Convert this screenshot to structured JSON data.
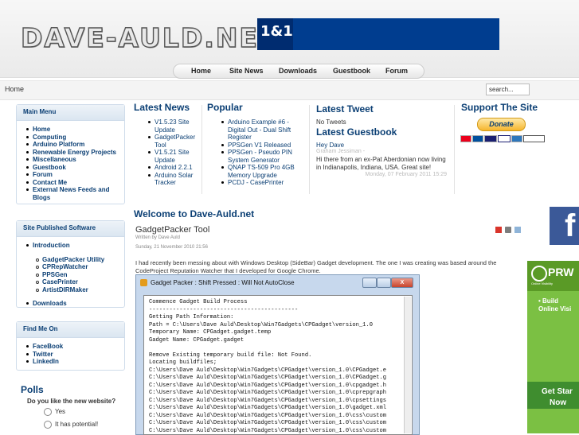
{
  "header": {
    "logo_text": "DAVE-AULD.NET",
    "banner_logo": "1&1",
    "nav": [
      "Home",
      "Site News",
      "Downloads",
      "Guestbook",
      "Forum"
    ]
  },
  "breadcrumb": "Home",
  "search": {
    "value": "search..."
  },
  "sidebar": {
    "main_menu": {
      "title": "Main Menu",
      "items": [
        "Home",
        "Computing",
        "Arduino Platform",
        "Renewable Energy Projects",
        "Miscellaneous",
        "Guestbook",
        "Forum",
        "Contact Me",
        "External News Feeds and Blogs"
      ]
    },
    "software": {
      "title": "Site Published Software",
      "items": [
        "Introduction",
        "GadgetPacker Utility",
        "CPRepWatcher",
        "PPSGen",
        "CasePrinter",
        "ArtistDIRMaker",
        "Downloads"
      ]
    },
    "find_me": {
      "title": "Find Me On",
      "items": [
        "FaceBook",
        "Twitter",
        "LinkedIn"
      ]
    },
    "polls": {
      "title": "Polls",
      "question": "Do you like the new website?",
      "options": [
        "Yes",
        "It has potential!"
      ]
    }
  },
  "latest_news": {
    "title": "Latest News",
    "items": [
      "V1.5.23 Site Update",
      "GadgetPacker Tool",
      "V1.5.21 Site Update",
      "Android 2.2.1",
      "Arduino Solar Tracker"
    ]
  },
  "popular": {
    "title": "Popular",
    "items": [
      "Arduino Example #6 - Digital Out - Dual Shift Register",
      "PPSGen V1 Released",
      "PPSGen - Pseudo PIN System Generator",
      "QNAP TS-509 Pro 4GB Memory Upgrade",
      "PCDJ - CasePrinter"
    ]
  },
  "tweet": {
    "title": "Latest Tweet",
    "text": "No Tweets"
  },
  "guestbook": {
    "title": "Latest Guestbook",
    "entry_title": "Hey Dave",
    "author": "Graham Jessiman -",
    "text": "Hi there from an ex-Pat Aberdonian now living in Indianapolis, Indiana, USA. Great site!",
    "date": "Monday, 07 February 2011 15:29"
  },
  "support": {
    "title": "Support The Site",
    "button": "Donate"
  },
  "article": {
    "section": "Welcome to Dave-Auld.net",
    "title": "GadgetPacker Tool",
    "author": "Written by Dave Auld",
    "date": "Sunday, 21 November 2010 21:56",
    "body": "I had recently been messing about with Windows Desktop (SideBar) Gadget development. The one I was creating was based around the CodeProject Reputation Watcher that I developed for Google Chrome."
  },
  "window": {
    "title": "Gadget Packer : Shift Pressed : Will Not AutoClose",
    "close_label": "X",
    "lines": [
      "Commence Gadget Build Process",
      "--------------------------------------------",
      "Getting Path Information:",
      "Path = C:\\Users\\Dave Auld\\Desktop\\Win7Gadgets\\CPGadget\\version_1.0",
      "Temporary Name: CPGadget.gadget.temp",
      "Gadget Name: CPGadget.gadget",
      "",
      "Remove Existing temporary build file: Not Found.",
      "Locating buildfiles;",
      "C:\\Users\\Dave Auld\\Desktop\\Win7Gadgets\\CPGadget\\version_1.0\\CPGadget.e",
      "C:\\Users\\Dave Auld\\Desktop\\Win7Gadgets\\CPGadget\\version_1.0\\CPGadget.g",
      "C:\\Users\\Dave Auld\\Desktop\\Win7Gadgets\\CPGadget\\version_1.0\\cpgadget.h",
      "C:\\Users\\Dave Auld\\Desktop\\Win7Gadgets\\CPGadget\\version_1.0\\cprepgraph",
      "C:\\Users\\Dave Auld\\Desktop\\Win7Gadgets\\CPGadget\\version_1.0\\cpsettings",
      "C:\\Users\\Dave Auld\\Desktop\\Win7Gadgets\\CPGadget\\version_1.0\\gadget.xml",
      "C:\\Users\\Dave Auld\\Desktop\\Win7Gadgets\\CPGadget\\version_1.0\\css\\custom",
      "C:\\Users\\Dave Auld\\Desktop\\Win7Gadgets\\CPGadget\\version_1.0\\css\\custom",
      "C:\\Users\\Dave Auld\\Desktop\\Win7Gadgets\\CPGadget\\version_1.0\\css\\custom"
    ]
  },
  "ads": {
    "facebook_letter": "f",
    "prw_title": "PRW",
    "prw_sub": "Online Visibility",
    "prw_build_1": "• Build",
    "prw_build_2": "Online Visi",
    "prw_cta_1": "Get Star",
    "prw_cta_2": "Now"
  },
  "colors": {
    "link": "#0b3f74",
    "banner": "#003d8f",
    "prw_green": "#7bc043"
  }
}
